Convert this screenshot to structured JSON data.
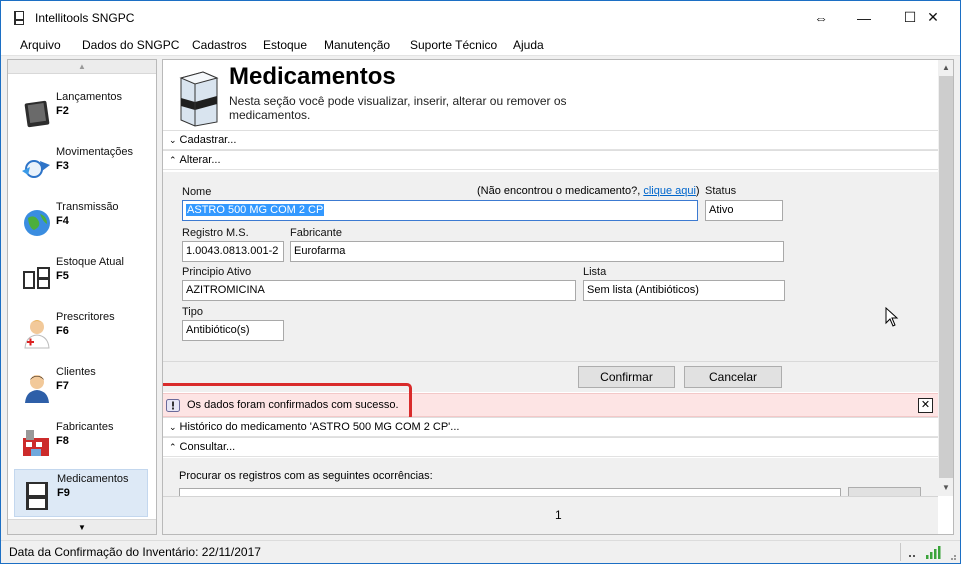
{
  "window": {
    "title": "Intellitools SNGPC",
    "controls": {
      "resize": "⇔",
      "minimize": "—",
      "maximize": "☐",
      "close": "✕"
    }
  },
  "menu": [
    "Arquivo",
    "Dados do SNGPC",
    "Cadastros",
    "Estoque",
    "Manutenção",
    "Suporte Técnico",
    "Ajuda"
  ],
  "sidebar": {
    "scroll_up": "▲",
    "scroll_down": "▼",
    "items": [
      {
        "label": "Lançamentos",
        "key": "F2",
        "icon": "ledger-book-icon"
      },
      {
        "label": "Movimentações",
        "key": "F3",
        "icon": "transfer-arrows-icon"
      },
      {
        "label": "Transmissão",
        "key": "F4",
        "icon": "globe-icon"
      },
      {
        "label": "Estoque Atual",
        "key": "F5",
        "icon": "stock-boxes-icon"
      },
      {
        "label": "Prescritores",
        "key": "F6",
        "icon": "doctor-icon"
      },
      {
        "label": "Clientes",
        "key": "F7",
        "icon": "customer-icon"
      },
      {
        "label": "Fabricantes",
        "key": "F8",
        "icon": "factory-icon"
      },
      {
        "label": "Medicamentos",
        "key": "F9",
        "icon": "medicine-box-icon",
        "active": true
      }
    ]
  },
  "header": {
    "title": "Medicamentos",
    "description": "Nesta seção você pode visualizar, inserir, alterar ou remover os medicamentos."
  },
  "sections": {
    "cadastrar": "Cadastrar...",
    "alterar": "Alterar...",
    "historico": "Histórico do medicamento 'ASTRO 500 MG COM 2 CP'...",
    "consultar": "Consultar..."
  },
  "form": {
    "nome_label": "Nome",
    "nome_value": "ASTRO 500 MG COM 2 CP",
    "notfound_prefix": "(Não encontrou o medicamento?, ",
    "notfound_link": "clique aqui",
    "notfound_suffix": ")",
    "status_label": "Status",
    "status_value": "Ativo",
    "registro_label": "Registro M.S.",
    "registro_value": "1.0043.0813.001-2",
    "fabricante_label": "Fabricante",
    "fabricante_value": "Eurofarma",
    "principio_label": "Principio Ativo",
    "principio_value": "AZITROMICINA",
    "lista_label": "Lista",
    "lista_value": "Sem lista (Antibióticos)",
    "tipo_label": "Tipo",
    "tipo_value": "Antibiótico(s)"
  },
  "actions": {
    "confirm": "Confirmar",
    "cancel": "Cancelar"
  },
  "alert": {
    "message": "Os dados foram confirmados com sucesso.",
    "close": "✕",
    "bg_color": "#fde4e4",
    "highlight_color": "#d92b2b"
  },
  "search": {
    "label": "Procurar os registros com as seguintes ocorrências:"
  },
  "pager": {
    "page": "1"
  },
  "status_bar": {
    "text": "Data da Confirmação do Inventário: 22/11/2017"
  }
}
